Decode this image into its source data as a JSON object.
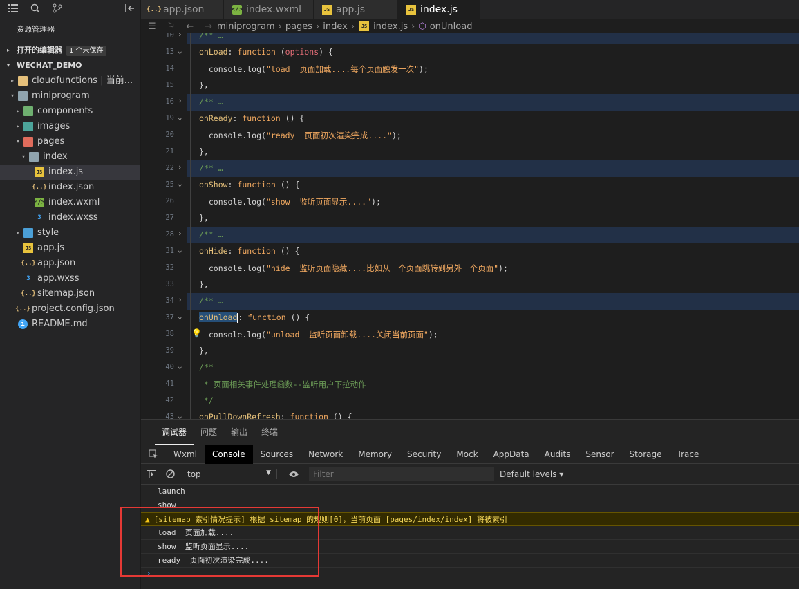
{
  "sidebar": {
    "activity_icons": [
      "list-icon",
      "search-icon",
      "source-control-icon",
      "collapse-panel-icon"
    ],
    "explorer_title": "资源管理器",
    "open_editors_label": "打开的编辑器",
    "unsaved_badge": "1 个未保存",
    "workspace_label": "WECHAT_DEMO",
    "tree": [
      {
        "label": "cloudfunctions | 当前...",
        "depth": 1,
        "twist": "▸",
        "icon": "folder y",
        "glyph": ""
      },
      {
        "label": "miniprogram",
        "depth": 1,
        "twist": "▾",
        "icon": "folder gr",
        "glyph": ""
      },
      {
        "label": "components",
        "depth": 2,
        "twist": "▸",
        "icon": "folder g",
        "glyph": ""
      },
      {
        "label": "images",
        "depth": 2,
        "twist": "▸",
        "icon": "folder t",
        "glyph": ""
      },
      {
        "label": "pages",
        "depth": 2,
        "twist": "▾",
        "icon": "folder r",
        "glyph": ""
      },
      {
        "label": "index",
        "depth": 3,
        "twist": "▾",
        "icon": "folder gr",
        "glyph": ""
      },
      {
        "label": "index.js",
        "depth": 4,
        "twist": "",
        "icon": "js",
        "glyph": "JS",
        "selected": true
      },
      {
        "label": "index.json",
        "depth": 4,
        "twist": "",
        "icon": "json",
        "glyph": "{..}"
      },
      {
        "label": "index.wxml",
        "depth": 4,
        "twist": "",
        "icon": "wxml",
        "glyph": "</>"
      },
      {
        "label": "index.wxss",
        "depth": 4,
        "twist": "",
        "icon": "wxss",
        "glyph": "3"
      },
      {
        "label": "style",
        "depth": 2,
        "twist": "▸",
        "icon": "folder b",
        "glyph": ""
      },
      {
        "label": "app.js",
        "depth": 2,
        "twist": "",
        "icon": "js",
        "glyph": "JS"
      },
      {
        "label": "app.json",
        "depth": 2,
        "twist": "",
        "icon": "json",
        "glyph": "{..}"
      },
      {
        "label": "app.wxss",
        "depth": 2,
        "twist": "",
        "icon": "wxss",
        "glyph": "3"
      },
      {
        "label": "sitemap.json",
        "depth": 2,
        "twist": "",
        "icon": "json",
        "glyph": "{..}"
      },
      {
        "label": "project.config.json",
        "depth": 1,
        "twist": "",
        "icon": "json",
        "glyph": "{..}"
      },
      {
        "label": "README.md",
        "depth": 1,
        "twist": "",
        "icon": "info",
        "glyph": "i"
      }
    ]
  },
  "tabs": [
    {
      "label": "app.json",
      "icon": "json",
      "glyph": "{..}"
    },
    {
      "label": "index.wxml",
      "icon": "wxml",
      "glyph": "</>"
    },
    {
      "label": "app.js",
      "icon": "js",
      "glyph": "JS"
    },
    {
      "label": "index.js",
      "icon": "js",
      "glyph": "JS",
      "active": true,
      "dirty": true
    }
  ],
  "breadcrumb": [
    "miniprogram",
    "pages",
    "index",
    "index.js",
    "onUnload"
  ],
  "editor": {
    "lines": [
      {
        "n": "10",
        "fold": "›",
        "html": "<span class='cm'>/** …</span>",
        "hl": true
      },
      {
        "n": "13",
        "fold": "⌄",
        "html": "<span class='fn'>onLoad</span>: <span class='kw'>function</span> (<span class='par'>options</span>) {"
      },
      {
        "n": "14",
        "html": "  console.log(<span class='str'>\"load  页面加载....每个页面触发一次\"</span>);"
      },
      {
        "n": "15",
        "html": "},"
      },
      {
        "n": "16",
        "fold": "›",
        "html": "<span class='cm'>/** …</span>",
        "hl": true
      },
      {
        "n": "19",
        "fold": "⌄",
        "html": "<span class='fn'>onReady</span>: <span class='kw'>function</span> () {"
      },
      {
        "n": "20",
        "html": "  console.log(<span class='str'>\"ready  页面初次渲染完成....\"</span>);"
      },
      {
        "n": "21",
        "html": "},"
      },
      {
        "n": "22",
        "fold": "›",
        "html": "<span class='cm'>/** …</span>",
        "hl": true
      },
      {
        "n": "25",
        "fold": "⌄",
        "html": "<span class='fn'>onShow</span>: <span class='kw'>function</span> () {"
      },
      {
        "n": "26",
        "html": "  console.log(<span class='str'>\"show  监听页面显示....\"</span>);"
      },
      {
        "n": "27",
        "html": "},"
      },
      {
        "n": "28",
        "fold": "›",
        "html": "<span class='cm'>/** …</span>",
        "hl": true
      },
      {
        "n": "31",
        "fold": "⌄",
        "html": "<span class='fn'>onHide</span>: <span class='kw'>function</span> () {"
      },
      {
        "n": "32",
        "html": "  console.log(<span class='str'>\"hide  监听页面隐藏....比如从一个页面跳转到另外一个页面\"</span>);"
      },
      {
        "n": "33",
        "html": "},"
      },
      {
        "n": "34",
        "fold": "›",
        "html": "<span class='cm'>/** …</span>",
        "hl": true
      },
      {
        "n": "37",
        "fold": "⌄",
        "html": "<span class='sel-word'>onUnload</span><span class='cursor'></span>: <span class='kw'>function</span> () {"
      },
      {
        "n": "38",
        "bulb": true,
        "html": "  console.log(<span class='str'>\"unload  监听页面卸载....关闭当前页面\"</span>);"
      },
      {
        "n": "39",
        "html": "},"
      },
      {
        "n": "40",
        "fold": "⌄",
        "html": "<span class='cm'>/**</span>"
      },
      {
        "n": "41",
        "html": "<span class='cm'> * 页面相关事件处理函数--监听用户下拉动作</span>"
      },
      {
        "n": "42",
        "html": "<span class='cm'> */</span>"
      },
      {
        "n": "43",
        "fold": "⌄",
        "html": "<span class='fn'>onPullDownRefresh</span>: <span class='kw'>function</span> () {"
      }
    ]
  },
  "panel": {
    "tabs": [
      "调试器",
      "问题",
      "输出",
      "终端"
    ],
    "devtools_tabs": [
      "Wxml",
      "Console",
      "Sources",
      "Network",
      "Memory",
      "Security",
      "Mock",
      "AppData",
      "Audits",
      "Sensor",
      "Storage",
      "Trace"
    ],
    "context": "top",
    "filter_placeholder": "Filter",
    "levels": "Default levels ▾",
    "console_lines": [
      {
        "text": "launch",
        "type": "log"
      },
      {
        "text": "show",
        "type": "log"
      },
      {
        "text": "[sitemap 索引情况提示] 根据 sitemap 的规则[0]，当前页面 [pages/index/index] 将被索引",
        "type": "warn"
      },
      {
        "text": "load  页面加载....",
        "type": "log"
      },
      {
        "text": "show  监听页面显示....",
        "type": "log"
      },
      {
        "text": "ready  页面初次渲染完成....",
        "type": "log"
      }
    ],
    "prompt": "›"
  }
}
